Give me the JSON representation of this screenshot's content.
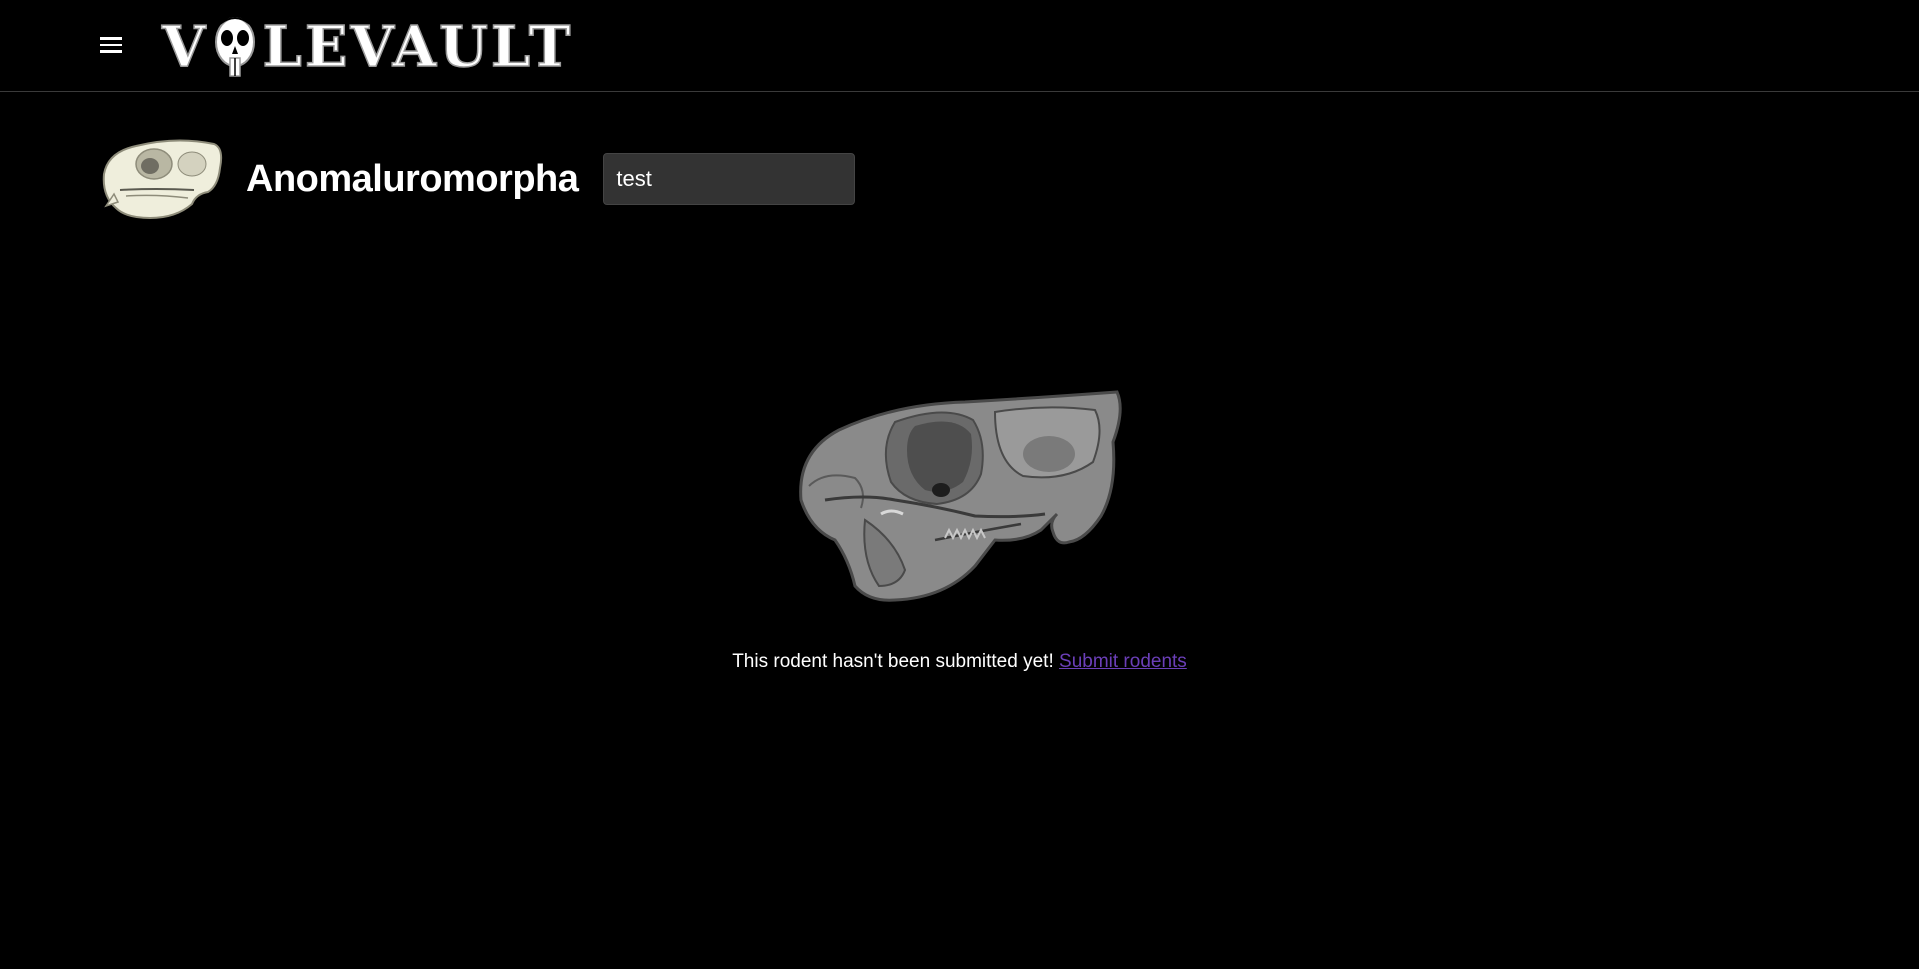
{
  "app": {
    "logo_text_left": "V",
    "logo_text_right": "LEVAULT",
    "menu_icon": "hamburger-menu-icon",
    "logo_icon": "skull-icon"
  },
  "page": {
    "clade_name": "Anomaluromorpha",
    "search_value": "test"
  },
  "empty_state": {
    "message": "This rodent hasn't been submitted yet!",
    "link_label": "Submit rodents",
    "illustration_icon": "gray-rodent-skull-icon"
  },
  "colors": {
    "background": "#000000",
    "text": "#ffffff",
    "link": "#6b3fb8",
    "input_bg": "#333333",
    "divider": "#3a3a3a"
  }
}
